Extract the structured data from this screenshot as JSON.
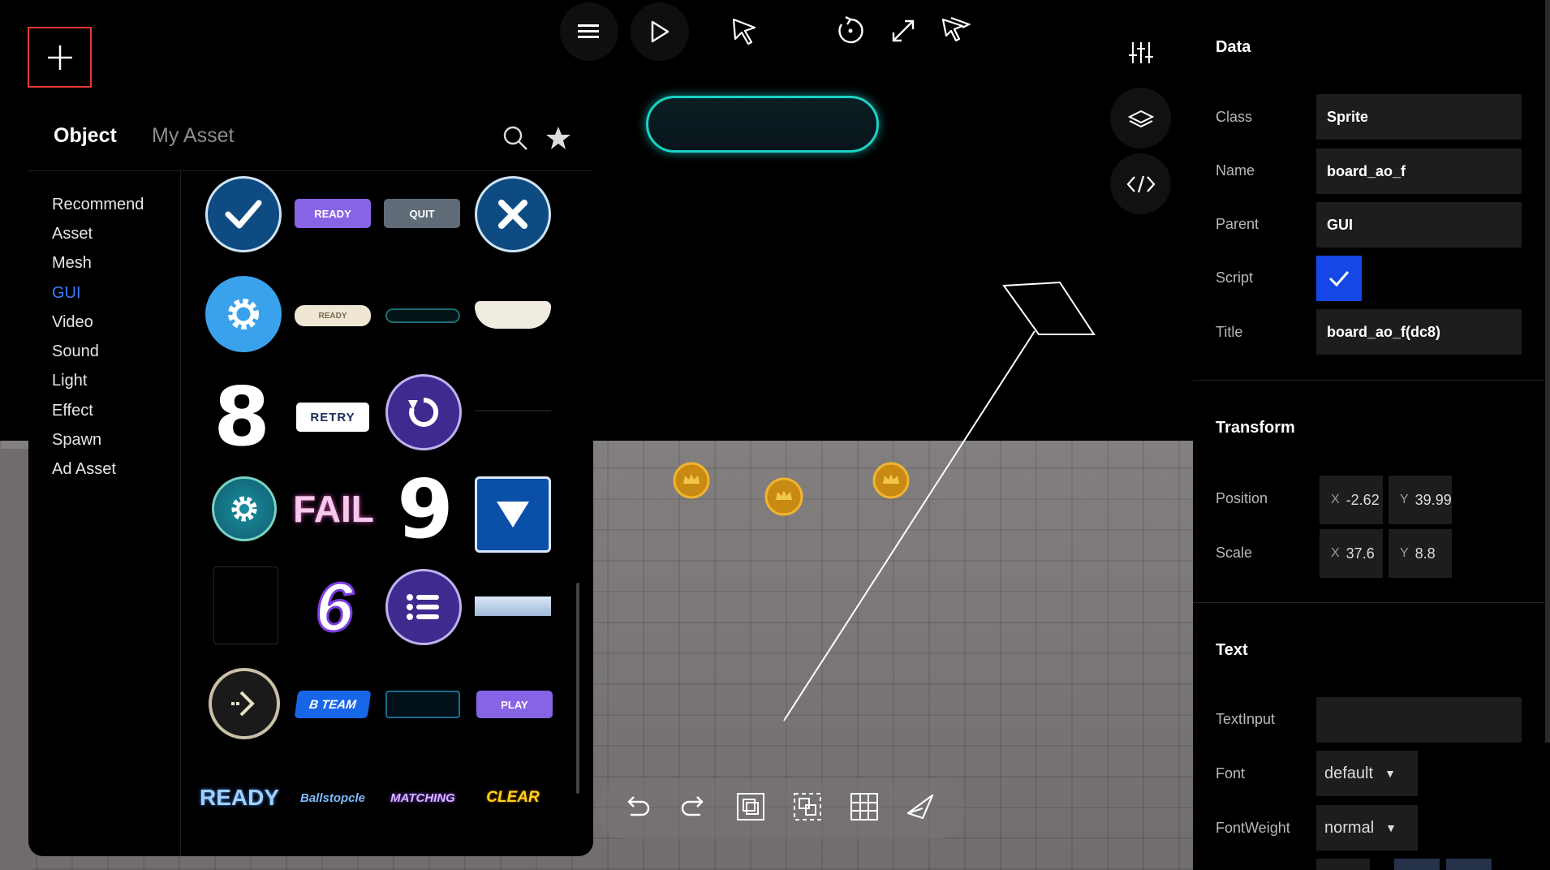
{
  "add_button": {
    "icon": "plus-icon"
  },
  "panel": {
    "tabs": [
      {
        "label": "Object"
      },
      {
        "label": "My Asset"
      }
    ],
    "categories": [
      {
        "label": "Recommend"
      },
      {
        "label": "Asset"
      },
      {
        "label": "Mesh"
      },
      {
        "label": "GUI"
      },
      {
        "label": "Video"
      },
      {
        "label": "Sound"
      },
      {
        "label": "Light"
      },
      {
        "label": "Effect"
      },
      {
        "label": "Spawn"
      },
      {
        "label": "Ad Asset"
      }
    ],
    "selected_category": "GUI",
    "assets": {
      "ready_purple": "READY",
      "quit": "QUIT",
      "ready_ribbon": "READY",
      "eight": "8",
      "retry": "RETRY",
      "fail": "FAIL",
      "nine": "9",
      "six": "6",
      "b_team": "B TEAM",
      "play": "PLAY",
      "ready_text": "READY",
      "ballstopcle": "Ballstopcle",
      "matching": "MATCHING",
      "clear": "CLEAR"
    }
  },
  "top_toolbar": {
    "items": [
      "menu-icon",
      "play-icon",
      "cursor-icon",
      "rotate-icon",
      "expand-icon",
      "multi-select-icon"
    ]
  },
  "right_panel": {
    "data": {
      "title": "Data",
      "class_label": "Class",
      "class_value": "Sprite",
      "name_label": "Name",
      "name_value": "board_ao_f",
      "parent_label": "Parent",
      "parent_value": "GUI",
      "script_label": "Script",
      "title_label": "Title",
      "title_value": "board_ao_f(dc8)"
    },
    "transform": {
      "title": "Transform",
      "position_label": "Position",
      "pos_x": "-2.62",
      "pos_y": "39.99",
      "scale_label": "Scale",
      "scale_x": "37.6",
      "scale_y": "8.8",
      "x_axis": "X",
      "y_axis": "Y"
    },
    "text": {
      "title": "Text",
      "textinput_label": "TextInput",
      "textinput_value": "",
      "font_label": "Font",
      "font_value": "default",
      "fontweight_label": "FontWeight",
      "fontweight_value": "normal"
    }
  },
  "colors": {
    "accent": "#1547e6",
    "selected_category": "#3d7dff",
    "add_border": "#e53935",
    "glow": "#1ad3c7"
  }
}
